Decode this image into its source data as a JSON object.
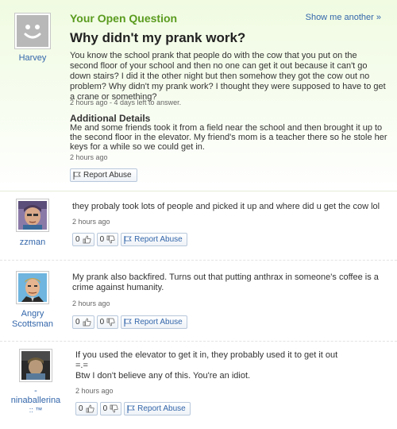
{
  "question": {
    "label": "Your Open Question",
    "show_another": "Show me another »",
    "title": "Why didn't my prank work?",
    "body": "You know the school prank that people do with the cow that you put on the second floor of your school and then no one can get it out because it can't go down stairs? I did it the other night but then somehow they got the cow out no problem? Why didn't my prank work? I thought they were supposed to have to get a crane or something?",
    "meta": "2 hours ago - 4 days left to answer.",
    "additional_title": "Additional Details",
    "additional_body": "Me and some friends took it from a field near the school and then brought it up to the second floor in the elevator. My friend's mom is a teacher there so he stole her keys for a while so we could get in.",
    "additional_meta": "2 hours ago",
    "report_label": "Report Abuse",
    "asker": {
      "name": "Harvey",
      "avatar_icon": "smiley-face-icon"
    }
  },
  "answers": [
    {
      "user": "zzman",
      "avatar_icon": "person-avatar-icon",
      "text": "they probaly took lots of people and picked it up and where did u get the cow lol",
      "meta": "2 hours ago",
      "thumbs_up": "0",
      "thumbs_down": "0",
      "report_label": "Report Abuse"
    },
    {
      "user": "Angry Scottsman",
      "avatar_icon": "cartoon-man-avatar-icon",
      "text": "My prank also backfired. Turns out that putting anthrax in someone's coffee is a crime against humanity.",
      "meta": "2 hours ago",
      "thumbs_up": "0",
      "thumbs_down": "0",
      "report_label": "Report Abuse"
    },
    {
      "user": "nina",
      "user_line1": "-",
      "user_line2": "ninaballerina",
      "user_line3": ":: ™",
      "avatar_icon": "person-photo-avatar-icon",
      "text_line1": "If you used the elevator to get it in, they probably used it to get it out",
      "text_line2": "=.=",
      "text_line3": "Btw I don't believe any of this. You're an idiot.",
      "meta": "2 hours ago",
      "thumbs_up": "0",
      "thumbs_down": "0",
      "report_label": "Report Abuse"
    }
  ],
  "colors": {
    "accent_green": "#5a9b1e",
    "link_blue": "#3366aa",
    "question_bg": "#f0fbe2"
  }
}
